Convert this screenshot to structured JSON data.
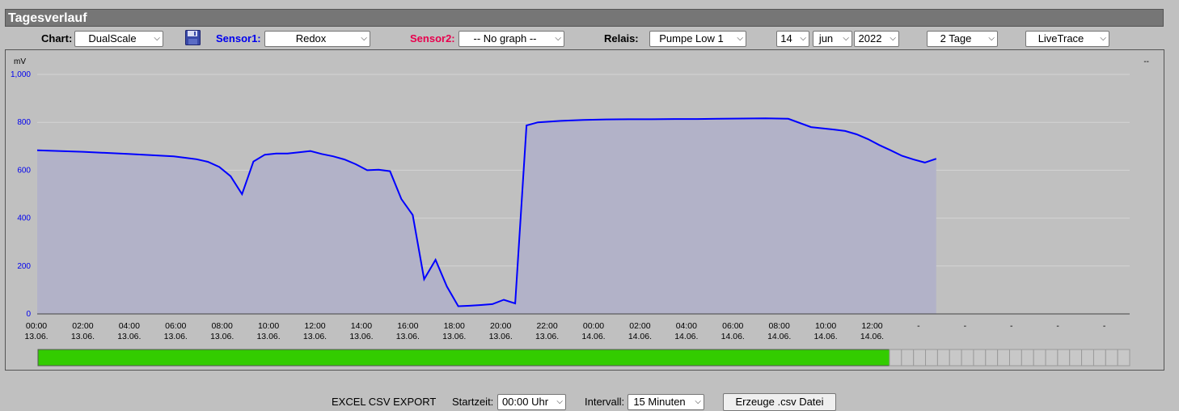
{
  "title": "Tagesverlauf",
  "controls": {
    "chart_label": "Chart:",
    "chart_value": "DualScale",
    "sensor1_label": "Sensor1:",
    "sensor1_value": "Redox",
    "sensor2_label": "Sensor2:",
    "sensor2_value": "-- No graph --",
    "relais_label": "Relais:",
    "relais_value": "Pumpe Low 1",
    "day": "14",
    "month": "jun",
    "year": "2022",
    "range": "2 Tage",
    "mode": "LiveTrace"
  },
  "colors": {
    "sensor1": "#0000ee",
    "sensor2": "#e8004d",
    "line": "#0000ff",
    "area": "#b2b2c8",
    "relay_on": "#33cc00"
  },
  "chart_data": {
    "type": "area",
    "unit_left": "mV",
    "unit_right": "--",
    "ylim": [
      0,
      1000
    ],
    "yticks": [
      "0",
      "200",
      "400",
      "600",
      "800",
      "1,000"
    ],
    "xticks": [
      [
        "00:00",
        "13.06."
      ],
      [
        "02:00",
        "13.06."
      ],
      [
        "04:00",
        "13.06."
      ],
      [
        "06:00",
        "13.06."
      ],
      [
        "08:00",
        "13.06."
      ],
      [
        "10:00",
        "13.06."
      ],
      [
        "12:00",
        "13.06."
      ],
      [
        "14:00",
        "13.06."
      ],
      [
        "16:00",
        "13.06."
      ],
      [
        "18:00",
        "13.06."
      ],
      [
        "20:00",
        "13.06."
      ],
      [
        "22:00",
        "13.06."
      ],
      [
        "00:00",
        "14.06."
      ],
      [
        "02:00",
        "14.06."
      ],
      [
        "04:00",
        "14.06."
      ],
      [
        "06:00",
        "14.06."
      ],
      [
        "08:00",
        "14.06."
      ],
      [
        "10:00",
        "14.06."
      ],
      [
        "12:00",
        "14.06."
      ],
      [
        "-",
        ""
      ],
      [
        "-",
        ""
      ],
      [
        "-",
        ""
      ],
      [
        "-",
        ""
      ],
      [
        "-",
        ""
      ]
    ],
    "x_hours_max": 48,
    "grid": true,
    "series": [
      {
        "values": [
          [
            0,
            683
          ],
          [
            2,
            677
          ],
          [
            4,
            668
          ],
          [
            6,
            658
          ],
          [
            6.5,
            652
          ],
          [
            7,
            646
          ],
          [
            7.5,
            635
          ],
          [
            8,
            614
          ],
          [
            8.5,
            575
          ],
          [
            9,
            500
          ],
          [
            9.5,
            636
          ],
          [
            10,
            665
          ],
          [
            10.5,
            670
          ],
          [
            11,
            670
          ],
          [
            11.5,
            675
          ],
          [
            12,
            680
          ],
          [
            12.5,
            668
          ],
          [
            13,
            658
          ],
          [
            13.5,
            645
          ],
          [
            14,
            625
          ],
          [
            14.5,
            600
          ],
          [
            15,
            602
          ],
          [
            15.5,
            596
          ],
          [
            16,
            480
          ],
          [
            16.5,
            413
          ],
          [
            17,
            145
          ],
          [
            17.5,
            226
          ],
          [
            18,
            115
          ],
          [
            18.5,
            32
          ],
          [
            19,
            34
          ],
          [
            19.5,
            37
          ],
          [
            20,
            41
          ],
          [
            20.5,
            59
          ],
          [
            21,
            44
          ],
          [
            21.5,
            787
          ],
          [
            22,
            800
          ],
          [
            23,
            806
          ],
          [
            24,
            810
          ],
          [
            25,
            812
          ],
          [
            26,
            813
          ],
          [
            27,
            813
          ],
          [
            28,
            814
          ],
          [
            29,
            814
          ],
          [
            30,
            815
          ],
          [
            31,
            816
          ],
          [
            32,
            817
          ],
          [
            33,
            815
          ],
          [
            34,
            780
          ],
          [
            35,
            770
          ],
          [
            35.5,
            764
          ],
          [
            36,
            750
          ],
          [
            36.5,
            730
          ],
          [
            37,
            705
          ],
          [
            37.5,
            683
          ],
          [
            38,
            660
          ],
          [
            38.5,
            645
          ],
          [
            39,
            632
          ],
          [
            39.5,
            648
          ]
        ]
      }
    ],
    "relay_fraction": 0.78
  },
  "export": {
    "title": "EXCEL CSV EXPORT",
    "start_label": "Startzeit:",
    "start_value": "00:00 Uhr",
    "interval_label": "Intervall:",
    "interval_value": "15 Minuten",
    "button": "Erzeuge .csv Datei"
  }
}
